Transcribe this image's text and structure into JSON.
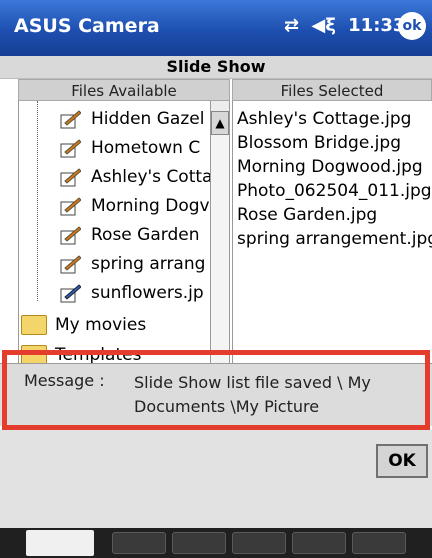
{
  "app": {
    "title": "ASUS Camera",
    "time": "11:33",
    "ok_label": "ok"
  },
  "dialog": {
    "title": "Slide Show"
  },
  "headers": {
    "files_available": "Files Available",
    "files_selected": "Files Selected"
  },
  "files_available": [
    "Hidden Gazel",
    "Hometown C",
    "Ashley's Cotta",
    "Morning Dogv",
    "Rose Garden",
    "spring arrang",
    "sunflowers.jp"
  ],
  "folders": [
    "My movies",
    "Templates"
  ],
  "files_selected": [
    "Ashley's Cottage.jpg",
    "Blossom Bridge.jpg",
    "Morning Dogwood.jpg",
    "Photo_062504_011.jpg",
    "Rose Garden.jpg",
    "spring arrangement.jpg"
  ],
  "message": {
    "label": "Message :",
    "text": "Slide Show list file saved  \\ My Documents \\My Picture"
  },
  "buttons": {
    "ok": "OK"
  },
  "colors": {
    "titlebar": "#1d4fb0",
    "highlight": "#e53d2d"
  },
  "icons": {
    "sync": "sync-icon",
    "volume": "volume-icon",
    "doc": "document-icon",
    "folder": "folder-icon"
  }
}
